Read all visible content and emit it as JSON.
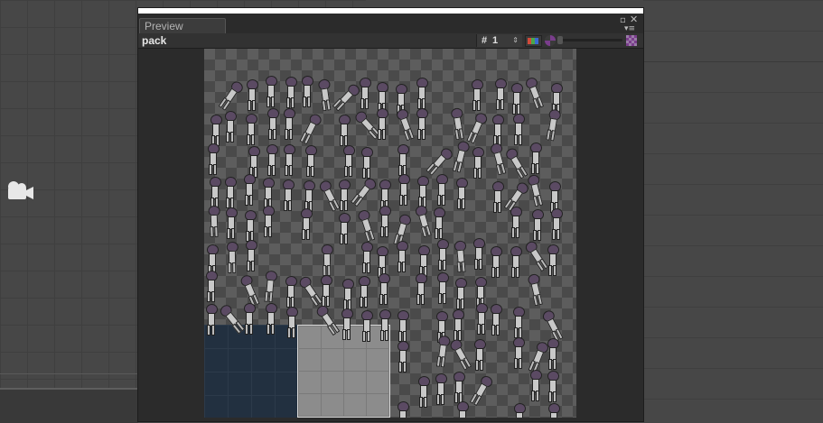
{
  "window": {
    "tab_label": "Preview",
    "asset_name": "pack",
    "frame_hash": "#",
    "frame_number": "1"
  },
  "icons": {
    "maximize": "maximize-icon",
    "close": "close-icon",
    "menu": "menu-icon",
    "spinner": "spinner-icon",
    "rgb": "rgb-channels-icon",
    "alpha": "alpha-icon",
    "mip": "mip-level-icon",
    "camera": "camera-icon"
  },
  "colors": {
    "window_bg": "#2b2b2b",
    "checker_light": "#5d5d5d",
    "checker_dark": "#4a4a4a",
    "sprite_head": "#5b4a63",
    "blue_block": "#223040",
    "gray_block": "#8c8c8c"
  }
}
